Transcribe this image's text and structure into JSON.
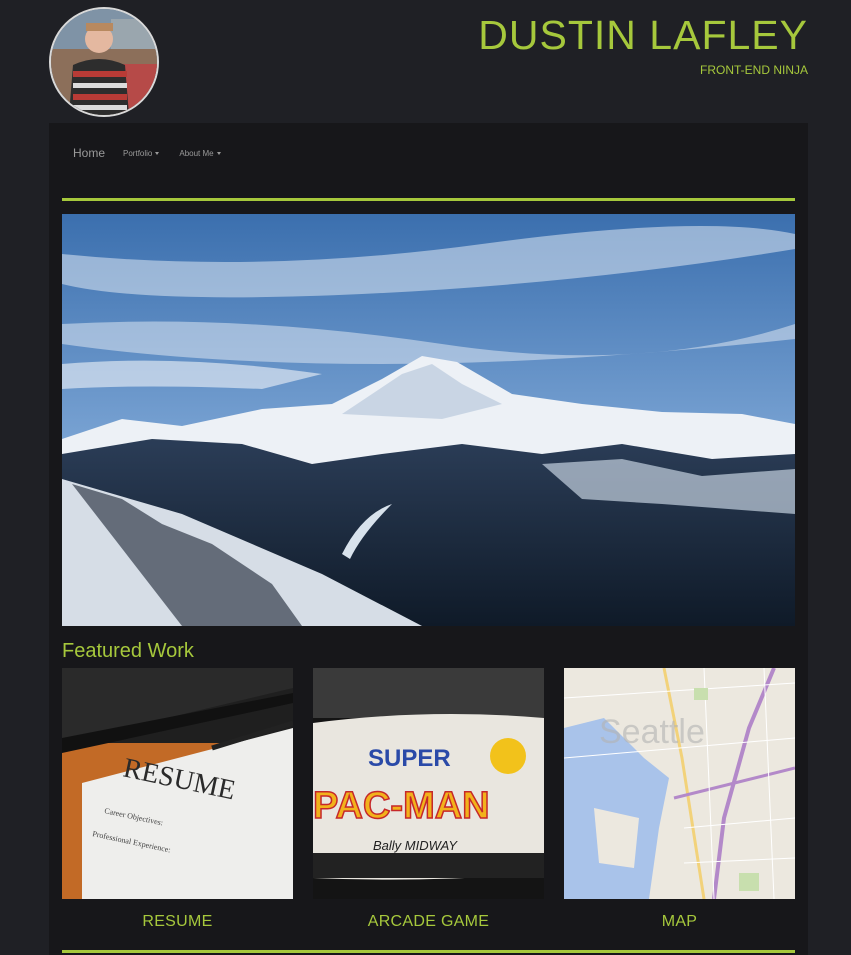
{
  "header": {
    "title": "DUSTIN LAFLEY",
    "tagline": "FRONT-END NINJA"
  },
  "nav": {
    "home": "Home",
    "portfolio": "Portfolio",
    "about": "About Me"
  },
  "featured": {
    "heading": "Featured Work",
    "items": [
      {
        "label": "RESUME",
        "thumb_resume_title": "RESUME",
        "thumb_line1": "Career Objectives:",
        "thumb_line2": "Professional Experience:"
      },
      {
        "label": "ARCADE GAME",
        "thumb_top": "SUPER",
        "thumb_main": "PAC-MAN",
        "thumb_brand": "Bally MIDWAY"
      },
      {
        "label": "MAP",
        "thumb_city": "Seattle"
      }
    ]
  },
  "colors": {
    "accent": "#a6c83c",
    "background": "#1f2025",
    "panel": "#17171a"
  }
}
